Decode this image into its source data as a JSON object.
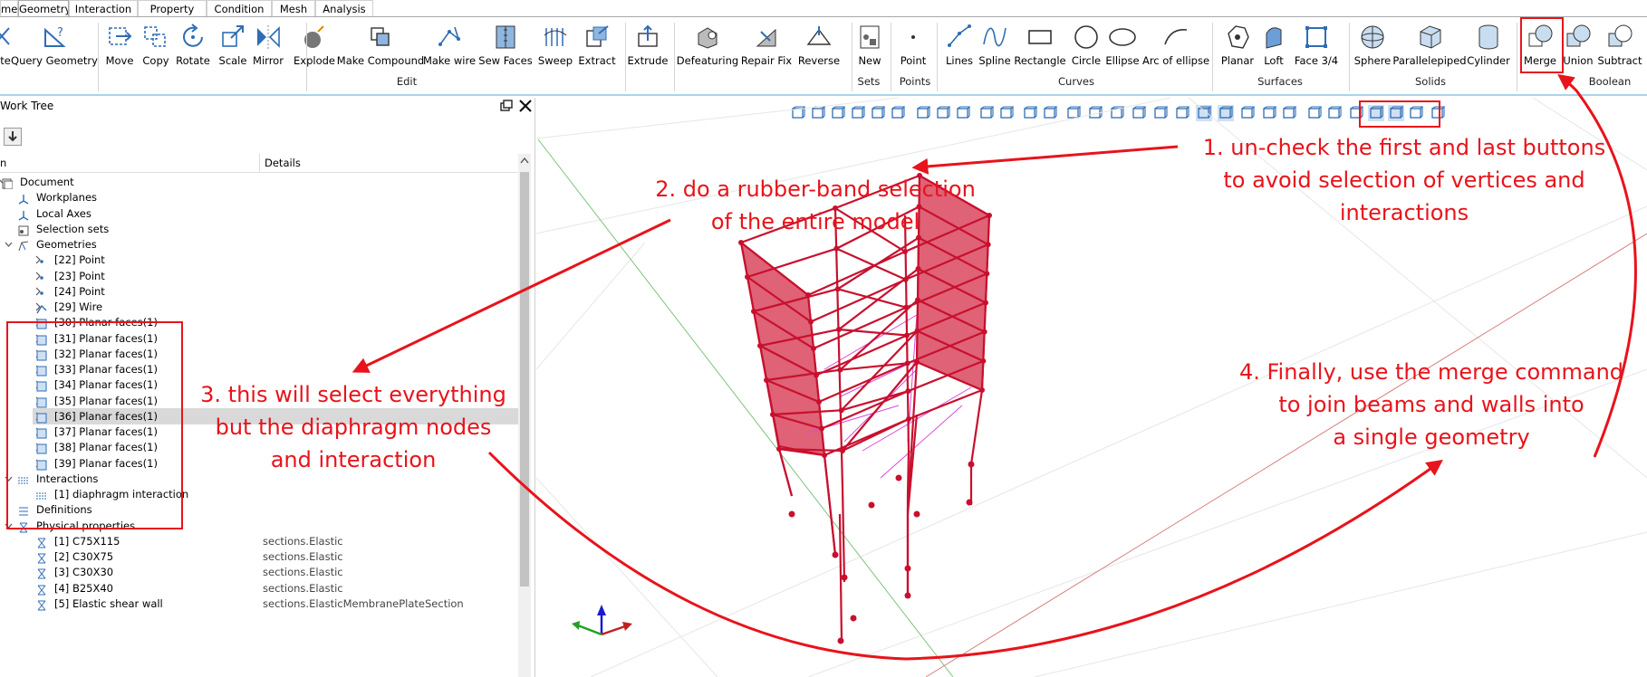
{
  "menu_tabs": [
    {
      "label": "me",
      "active": false
    },
    {
      "label": "Geometry",
      "active": true
    },
    {
      "label": "Interaction",
      "active": false
    },
    {
      "label": "Property",
      "active": false
    },
    {
      "label": "Condition",
      "active": false
    },
    {
      "label": "Mesh",
      "active": false
    },
    {
      "label": "Analysis",
      "active": false
    }
  ],
  "ribbon": {
    "buttons": [
      {
        "label": "te",
        "icon": "cut-icon"
      },
      {
        "label": "Query Geometry",
        "icon": "query-geometry-icon"
      },
      {
        "label": "Move",
        "icon": "move-icon"
      },
      {
        "label": "Copy",
        "icon": "copy-icon"
      },
      {
        "label": "Rotate",
        "icon": "rotate-icon"
      },
      {
        "label": "Scale",
        "icon": "scale-icon"
      },
      {
        "label": "Mirror",
        "icon": "mirror-icon"
      },
      {
        "label": "Explode",
        "icon": "explode-icon"
      },
      {
        "label": "Make Compound",
        "icon": "make-compound-icon"
      },
      {
        "label": "Make wire",
        "icon": "make-wire-icon"
      },
      {
        "label": "Sew Faces",
        "icon": "sew-faces-icon"
      },
      {
        "label": "Sweep",
        "icon": "sweep-icon"
      },
      {
        "label": "Extract",
        "icon": "extract-icon"
      },
      {
        "label": "Extrude",
        "icon": "extrude-icon"
      },
      {
        "label": "Defeaturing",
        "icon": "defeaturing-icon"
      },
      {
        "label": "Repair Fix",
        "icon": "repair-fix-icon"
      },
      {
        "label": "Reverse",
        "icon": "reverse-icon"
      },
      {
        "label": "New",
        "icon": "new-set-icon"
      },
      {
        "label": "Point",
        "icon": "point-icon"
      },
      {
        "label": "Lines",
        "icon": "lines-icon"
      },
      {
        "label": "Spline",
        "icon": "spline-icon"
      },
      {
        "label": "Rectangle",
        "icon": "rectangle-icon"
      },
      {
        "label": "Circle",
        "icon": "circle-icon"
      },
      {
        "label": "Ellipse",
        "icon": "ellipse-icon"
      },
      {
        "label": "Arc of ellipse",
        "icon": "arc-of-ellipse-icon"
      },
      {
        "label": "Planar",
        "icon": "planar-icon"
      },
      {
        "label": "Loft",
        "icon": "loft-icon"
      },
      {
        "label": "Face 3/4",
        "icon": "face-34-icon"
      },
      {
        "label": "Sphere",
        "icon": "sphere-icon"
      },
      {
        "label": "Parallelepiped",
        "icon": "parallelepiped-icon"
      },
      {
        "label": "Cylinder",
        "icon": "cylinder-icon"
      },
      {
        "label": "Merge",
        "icon": "merge-icon"
      },
      {
        "label": "Union",
        "icon": "union-icon"
      },
      {
        "label": "Subtract",
        "icon": "subtract-icon"
      }
    ],
    "groups": {
      "edit": "Edit",
      "sets": "Sets",
      "points": "Points",
      "curves": "Curves",
      "surfaces": "Surfaces",
      "solids": "Solids",
      "boolean": "Boolean"
    }
  },
  "panel": {
    "title": "Work Tree",
    "col_name": "n",
    "col_details": "Details",
    "rows": [
      {
        "label": "Document",
        "detail": "",
        "icon": "document-icon",
        "chev": "v",
        "indent": 0
      },
      {
        "label": "Workplanes",
        "detail": "",
        "icon": "workplanes-icon",
        "chev": "",
        "indent": 1
      },
      {
        "label": "Local Axes",
        "detail": "",
        "icon": "local-axes-icon",
        "chev": "",
        "indent": 1
      },
      {
        "label": "Selection sets",
        "detail": "",
        "icon": "selection-sets-icon",
        "chev": "",
        "indent": 1
      },
      {
        "label": "Geometries",
        "detail": "",
        "icon": "geometries-icon",
        "chev": "v",
        "indent": 1
      },
      {
        "label": "[22] Point",
        "detail": "",
        "icon": "point-icon",
        "chev": ">",
        "indent": 2
      },
      {
        "label": "[23] Point",
        "detail": "",
        "icon": "point-icon",
        "chev": ">",
        "indent": 2
      },
      {
        "label": "[24] Point",
        "detail": "",
        "icon": "point-icon",
        "chev": ">",
        "indent": 2
      },
      {
        "label": "[29] Wire",
        "detail": "",
        "icon": "wire-icon",
        "chev": ">",
        "indent": 2
      },
      {
        "label": "[30] Planar faces(1)",
        "detail": "",
        "icon": "planar-face-icon",
        "chev": ">",
        "indent": 2
      },
      {
        "label": "[31] Planar faces(1)",
        "detail": "",
        "icon": "planar-face-icon",
        "chev": ">",
        "indent": 2
      },
      {
        "label": "[32] Planar faces(1)",
        "detail": "",
        "icon": "planar-face-icon",
        "chev": ">",
        "indent": 2
      },
      {
        "label": "[33] Planar faces(1)",
        "detail": "",
        "icon": "planar-face-icon",
        "chev": ">",
        "indent": 2
      },
      {
        "label": "[34] Planar faces(1)",
        "detail": "",
        "icon": "planar-face-icon",
        "chev": ">",
        "indent": 2
      },
      {
        "label": "[35] Planar faces(1)",
        "detail": "",
        "icon": "planar-face-icon",
        "chev": ">",
        "indent": 2
      },
      {
        "label": "[36] Planar faces(1)",
        "detail": "",
        "icon": "planar-face-icon",
        "chev": ">",
        "indent": 2,
        "selected": true
      },
      {
        "label": "[37] Planar faces(1)",
        "detail": "",
        "icon": "planar-face-icon",
        "chev": ">",
        "indent": 2
      },
      {
        "label": "[38] Planar faces(1)",
        "detail": "",
        "icon": "planar-face-icon",
        "chev": ">",
        "indent": 2
      },
      {
        "label": "[39] Planar faces(1)",
        "detail": "",
        "icon": "planar-face-icon",
        "chev": ">",
        "indent": 2
      },
      {
        "label": "Interactions",
        "detail": "",
        "icon": "interactions-icon",
        "chev": "v",
        "indent": 1
      },
      {
        "label": "[1] diaphragm interaction",
        "detail": "",
        "icon": "interaction-icon",
        "chev": "",
        "indent": 2
      },
      {
        "label": "Definitions",
        "detail": "",
        "icon": "definitions-icon",
        "chev": "",
        "indent": 1
      },
      {
        "label": "Physical properties",
        "detail": "",
        "icon": "physical-properties-icon",
        "chev": "v",
        "indent": 1
      },
      {
        "label": "[1] C75X115",
        "detail": "sections.Elastic",
        "icon": "section-icon",
        "chev": "",
        "indent": 2
      },
      {
        "label": "[2] C30X75",
        "detail": "sections.Elastic",
        "icon": "section-icon",
        "chev": "",
        "indent": 2
      },
      {
        "label": "[3] C30X30",
        "detail": "sections.Elastic",
        "icon": "section-icon",
        "chev": "",
        "indent": 2
      },
      {
        "label": "[4] B25X40",
        "detail": "sections.Elastic",
        "icon": "section-icon",
        "chev": "",
        "indent": 2
      },
      {
        "label": "[5] Elastic shear wall",
        "detail": "sections.ElasticMembranePlateSection",
        "icon": "section-icon",
        "chev": "",
        "indent": 2
      }
    ]
  },
  "annotations": {
    "step1": [
      "1. un-check the first and last buttons",
      "to avoid selection of vertices and",
      "interactions"
    ],
    "step2": [
      "2. do a rubber-band selection",
      "of the entire model"
    ],
    "step3": [
      "3. this will select everything",
      "but the diaphragm nodes",
      "and interaction"
    ],
    "step4": [
      "4. Finally, use the merge command",
      "to join beams and walls into",
      "a single geometry"
    ]
  },
  "colors": {
    "annotation": "#e8131b",
    "model": "#c8102e",
    "wall_fill": "#d9465e",
    "diaphragm": "#d84ad8",
    "ribbon_accent": "#a8d4ee",
    "icon_blue": "#2f6db5"
  }
}
